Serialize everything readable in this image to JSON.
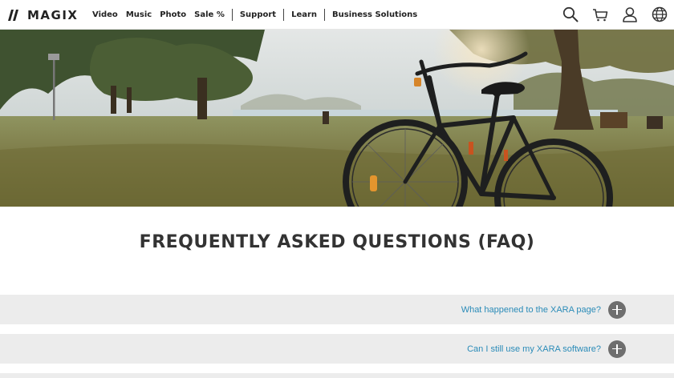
{
  "brand": {
    "name": "MAGIX"
  },
  "nav": {
    "items": [
      {
        "label": "Video"
      },
      {
        "label": "Music"
      },
      {
        "label": "Photo"
      },
      {
        "label": "Sale %"
      },
      {
        "label": "Support"
      },
      {
        "label": "Learn"
      },
      {
        "label": "Business Solutions"
      }
    ]
  },
  "header_icons": [
    "search-icon",
    "cart-icon",
    "user-icon",
    "globe-icon"
  ],
  "hero": {
    "image_subject": "bicycle-in-park"
  },
  "faq": {
    "title": "FREQUENTLY ASKED QUESTIONS (FAQ)",
    "items": [
      {
        "question": "What happened to the XARA page?"
      },
      {
        "question": "Can I still use my XARA software?"
      },
      {
        "question": ""
      }
    ]
  },
  "colors": {
    "link": "#2a8bb8",
    "faq_row_bg": "#ececec",
    "toggle_bg": "#6e6e6e",
    "heading": "#333333"
  }
}
